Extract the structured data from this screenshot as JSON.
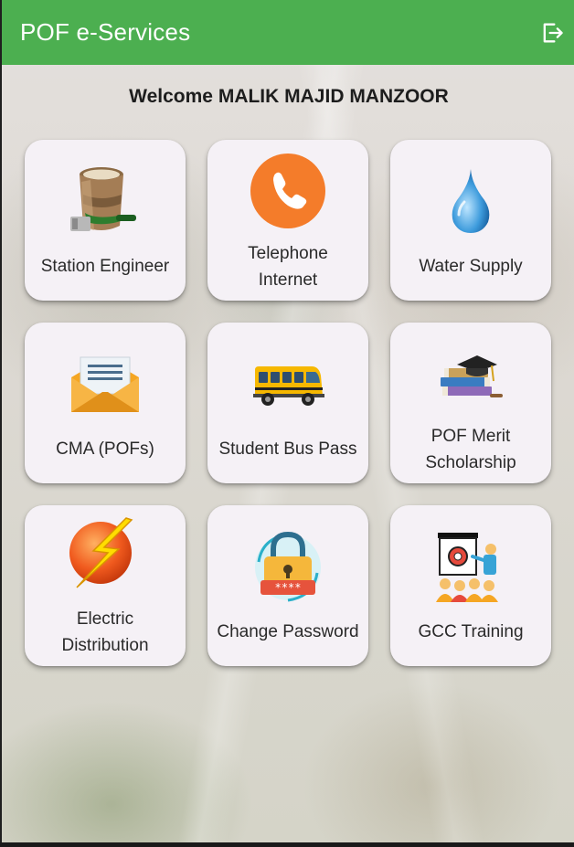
{
  "app": {
    "title": "POF e-Services"
  },
  "welcome": "Welcome MALIK MAJID MANZOOR",
  "tiles": [
    {
      "label": "Station Engineer",
      "icon": "paint-bucket-icon"
    },
    {
      "label": "Telephone Internet",
      "icon": "telephone-icon"
    },
    {
      "label": "Water Supply",
      "icon": "water-drop-icon"
    },
    {
      "label": "CMA (POFs)",
      "icon": "envelope-icon"
    },
    {
      "label": "Student Bus Pass",
      "icon": "school-bus-icon"
    },
    {
      "label": "POF Merit Scholarship",
      "icon": "graduation-books-icon"
    },
    {
      "label": "Electric Distribution",
      "icon": "lightning-bolt-icon"
    },
    {
      "label": "Change Password",
      "icon": "padlock-icon"
    },
    {
      "label": "GCC Training",
      "icon": "training-presentation-icon"
    }
  ],
  "colors": {
    "appbar": "#4caf50",
    "card": "#f5f1f6",
    "text": "#2a2a2a"
  }
}
